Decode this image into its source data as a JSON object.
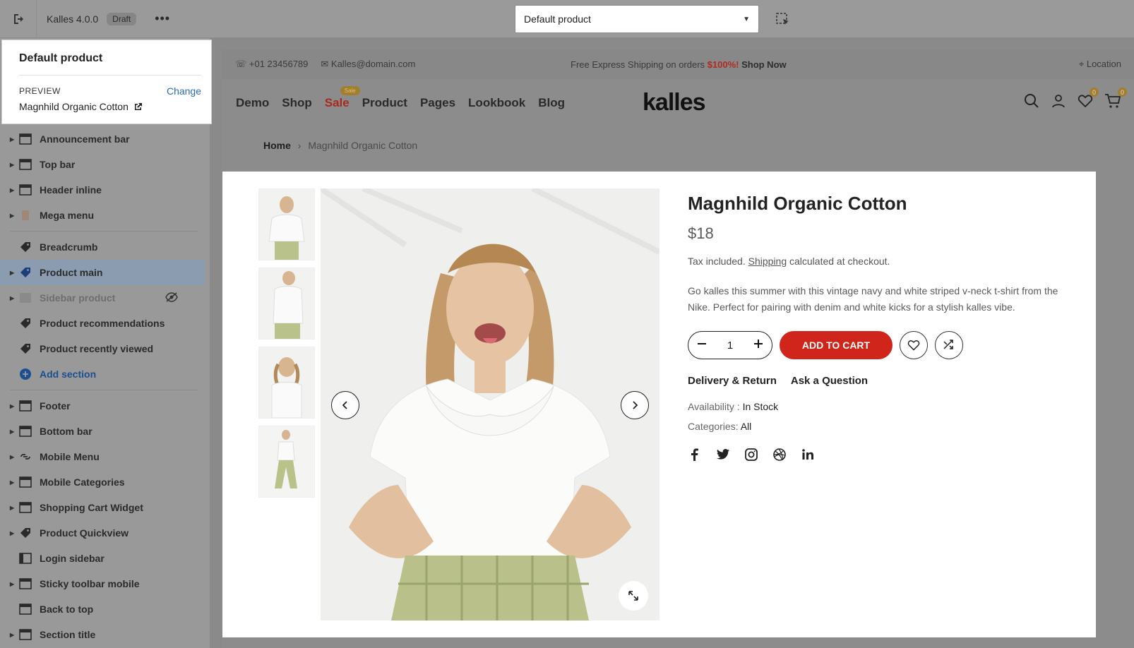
{
  "topbar": {
    "app_title": "Kalles 4.0.0",
    "status_badge": "Draft",
    "template_select_value": "Default product"
  },
  "template_popup": {
    "title": "Default product",
    "preview_label": "PREVIEW",
    "change_label": "Change",
    "preview_value": "Magnhild Organic Cotton"
  },
  "sections": {
    "header_group": [
      {
        "label": "Announcement bar",
        "icon": "layout-icon"
      },
      {
        "label": "Top bar",
        "icon": "layout-icon"
      },
      {
        "label": "Header inline",
        "icon": "layout-icon"
      },
      {
        "label": "Mega menu",
        "icon": "menu-image-icon"
      }
    ],
    "template_group": [
      {
        "label": "Breadcrumb",
        "icon": "tag-icon"
      },
      {
        "label": "Product main",
        "icon": "tag-icon"
      },
      {
        "label": "Sidebar product",
        "icon": "image-icon"
      },
      {
        "label": "Product recommendations",
        "icon": "tag-icon"
      },
      {
        "label": "Product recently viewed",
        "icon": "tag-icon"
      }
    ],
    "add_section_label": "Add section",
    "footer_group": [
      {
        "label": "Footer"
      },
      {
        "label": "Bottom bar"
      },
      {
        "label": "Mobile Menu"
      },
      {
        "label": "Mobile Categories"
      },
      {
        "label": "Shopping Cart Widget"
      },
      {
        "label": "Product Quickview"
      },
      {
        "label": "Login sidebar"
      },
      {
        "label": "Sticky toolbar mobile"
      },
      {
        "label": "Back to top"
      },
      {
        "label": "Section title"
      }
    ]
  },
  "store": {
    "announce": {
      "phone": "+01 23456789",
      "email": "Kalles@domain.com",
      "shipping_text": "Free Express Shipping on orders ",
      "shipping_highlight": "$100%!",
      "shop_now": " Shop Now",
      "location": "Location"
    },
    "nav": {
      "links": [
        "Demo",
        "Shop",
        "Sale",
        "Product",
        "Pages",
        "Lookbook",
        "Blog"
      ],
      "sale_tag": "Sale",
      "logo": "kalles",
      "wishlist_count": "0",
      "cart_count": "0"
    },
    "breadcrumb": {
      "home": "Home",
      "separator": "›",
      "current": "Magnhild Organic Cotton"
    },
    "product": {
      "name": "Magnhild Organic Cotton",
      "price": "$18",
      "tax_prefix": "Tax included. ",
      "tax_link": "Shipping",
      "tax_suffix": " calculated at checkout.",
      "description": "Go kalles this summer with this vintage navy and white striped v-neck t-shirt from the Nike. Perfect for pairing with denim and white kicks for a stylish kalles vibe.",
      "quantity": "1",
      "add_to_cart": "ADD TO CART",
      "delivery_label": "Delivery & Return",
      "ask_label": "Ask a Question",
      "availability_label": "Availability : ",
      "availability_value": "In Stock",
      "categories_label": "Categories: ",
      "categories_value": "All"
    }
  },
  "colors": {
    "accent_red": "#d0251b",
    "link_blue": "#2b6cb0",
    "sale_badge": "#a37e2d"
  }
}
